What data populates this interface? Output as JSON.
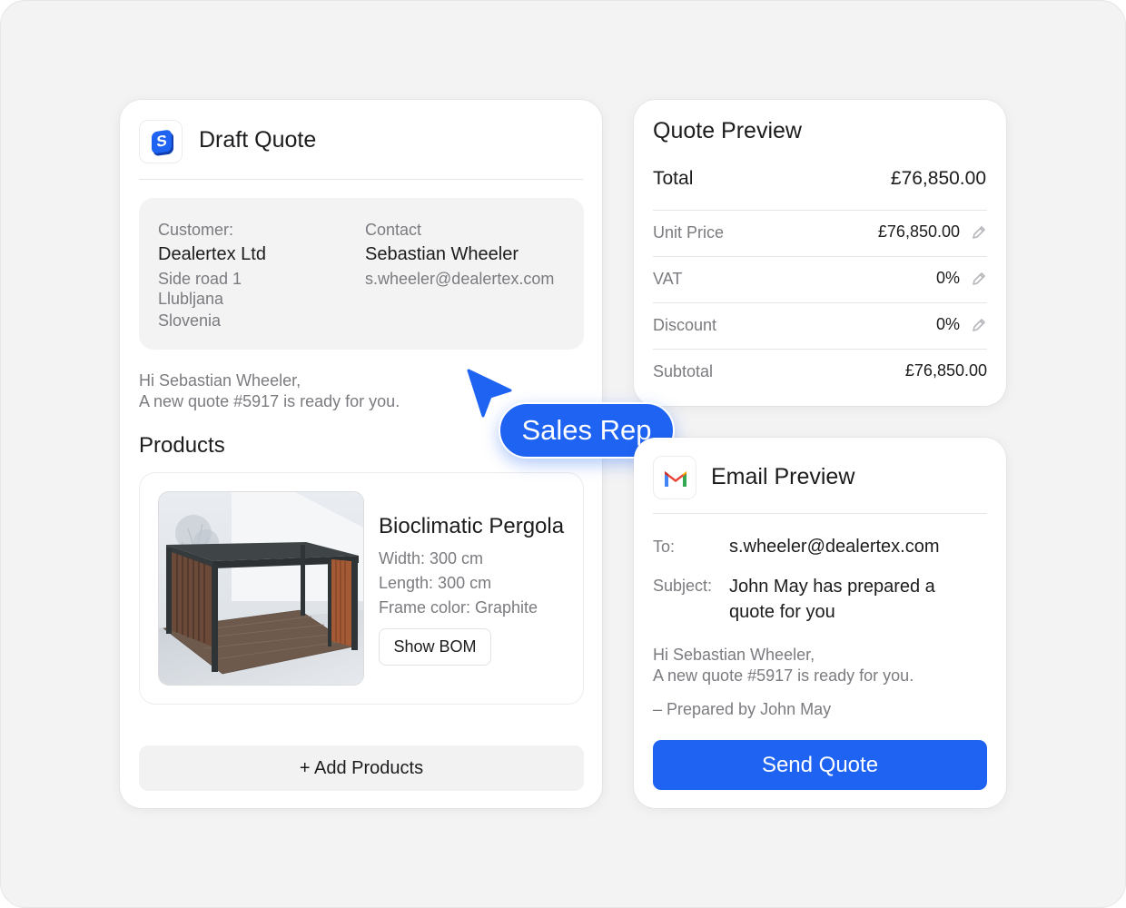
{
  "draft_quote": {
    "title": "Draft Quote",
    "logo_letter": "S",
    "customer_label": "Customer:",
    "customer_name": "Dealertex Ltd",
    "address": [
      "Side road 1",
      "Llubljana",
      "Slovenia"
    ],
    "contact_label": "Contact",
    "contact_name": "Sebastian Wheeler",
    "contact_email": "s.wheeler@dealertex.com",
    "greeting": [
      "Hi Sebastian Wheeler,",
      "A new quote #5917 is ready for you."
    ],
    "products_heading": "Products",
    "product": {
      "name": "Bioclimatic Pergola",
      "width": "Width: 300 cm",
      "length": "Length: 300 cm",
      "frame_color": "Frame color: Graphite",
      "bom_button": "Show BOM"
    },
    "add_products_button": "+ Add Products"
  },
  "quote_preview": {
    "title": "Quote Preview",
    "total_label": "Total",
    "total_value": "£76,850.00",
    "rows": [
      {
        "label": "Unit Price",
        "value": "£76,850.00",
        "editable": true
      },
      {
        "label": "VAT",
        "value": "0%",
        "editable": true
      },
      {
        "label": "Discount",
        "value": "0%",
        "editable": true
      },
      {
        "label": "Subtotal",
        "value": "£76,850.00",
        "editable": false
      }
    ]
  },
  "sales_rep": {
    "label": "Sales Rep"
  },
  "email_preview": {
    "title": "Email Preview",
    "to_label": "To:",
    "to_value": "s.wheeler@dealertex.com",
    "subject_label": "Subject:",
    "subject_value": "John May has prepared a quote for you",
    "body": [
      "Hi Sebastian Wheeler,",
      "A new quote #5917 is ready for you."
    ],
    "signature": "– Prepared by John May",
    "send_button": "Send Quote"
  },
  "colors": {
    "accent": "#1f63f2",
    "muted_text": "#7b7b80",
    "surface": "#f3f3f4"
  },
  "icons": [
    "logo-icon",
    "pencil-icon",
    "cursor-icon",
    "gmail-icon"
  ]
}
